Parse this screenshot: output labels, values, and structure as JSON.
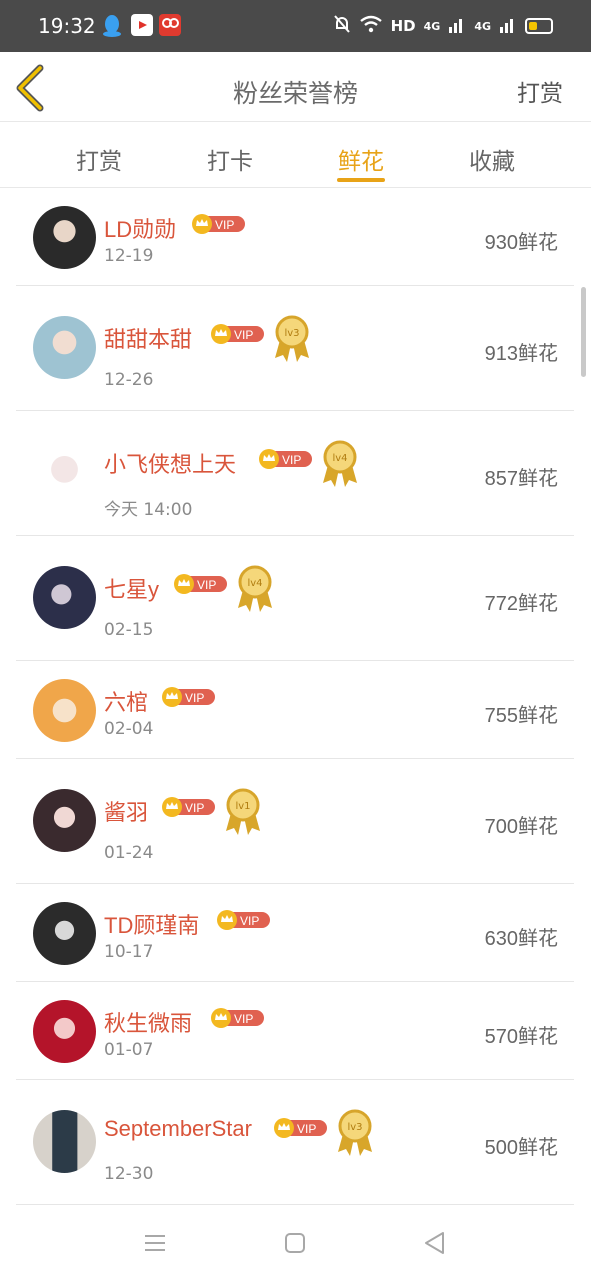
{
  "status_bar": {
    "time": "19:32",
    "network_label": "HD",
    "signal1_label": "4G",
    "signal2_label": "4G",
    "battery_level": 0.35,
    "icons": [
      "qq-icon",
      "video-app-icon",
      "music-app-icon",
      "mute-bell-icon",
      "wifi-icon",
      "signal-icon",
      "battery-icon"
    ]
  },
  "header": {
    "title": "粉丝荣誉榜",
    "action_label": "打赏",
    "back_icon": "chevron-left-icon",
    "accent_color": "#e8a317"
  },
  "tabs": [
    {
      "label": "打赏",
      "active": false
    },
    {
      "label": "打卡",
      "active": false
    },
    {
      "label": "鲜花",
      "active": true
    },
    {
      "label": "收藏",
      "active": false
    }
  ],
  "vip_label": "VIP",
  "fans": [
    {
      "name": "LD勋勋",
      "date": "12-19",
      "amount": "930鲜花",
      "medal": ""
    },
    {
      "name": "甜甜本甜",
      "date": "12-26",
      "amount": "913鲜花",
      "medal": "lv3"
    },
    {
      "name": "小飞侠想上天",
      "date": "今天 14:00",
      "amount": "857鲜花",
      "medal": "lv4"
    },
    {
      "name": "七星y",
      "date": "02-15",
      "amount": "772鲜花",
      "medal": "lv4"
    },
    {
      "name": "六棺",
      "date": "02-04",
      "amount": "755鲜花",
      "medal": ""
    },
    {
      "name": "酱羽",
      "date": "01-24",
      "amount": "700鲜花",
      "medal": "lv1"
    },
    {
      "name": "TD顾瑾南",
      "date": "10-17",
      "amount": "630鲜花",
      "medal": ""
    },
    {
      "name": "秋生微雨",
      "date": "01-07",
      "amount": "570鲜花",
      "medal": ""
    },
    {
      "name": "SeptemberStar",
      "date": "12-30",
      "amount": "500鲜花",
      "medal": "lv3"
    }
  ],
  "nav_bar": {
    "icons": [
      "menu-icon",
      "home-square-icon",
      "back-triangle-icon"
    ]
  }
}
